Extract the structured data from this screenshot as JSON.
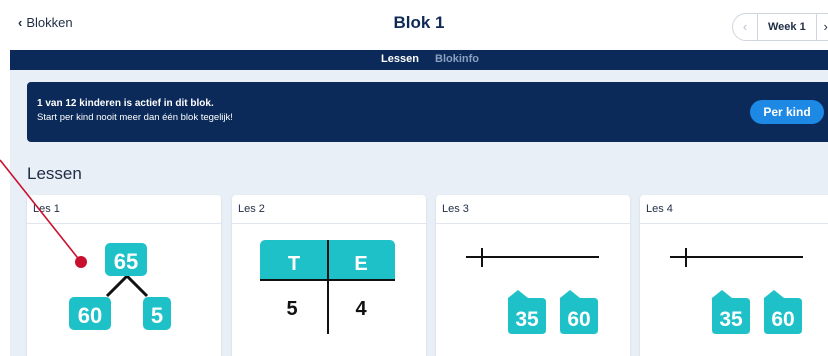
{
  "topbar": {
    "back_label": "Blokken",
    "title": "Blok 1",
    "week_label": "Week 1"
  },
  "subnav": {
    "tabs": [
      {
        "label": "Lessen",
        "active": true
      },
      {
        "label": "Blokinfo",
        "active": false
      }
    ]
  },
  "banner": {
    "line1": "1 van 12 kinderen is actief in dit blok.",
    "line2": "Start per kind nooit meer dan één blok tegelijk!",
    "button_label": "Per kind"
  },
  "section_title": "Lessen",
  "lessons": [
    {
      "label": "Les 1",
      "illustration": "number-split",
      "top": "65",
      "left": "60",
      "right": "5"
    },
    {
      "label": "Les 2",
      "illustration": "place-value-table",
      "headers": [
        "T",
        "E"
      ],
      "values": [
        "5",
        "4"
      ]
    },
    {
      "label": "Les 3",
      "illustration": "number-line",
      "tiles": [
        "35",
        "60"
      ]
    },
    {
      "label": "Les 4",
      "illustration": "number-line",
      "tiles": [
        "35",
        "60"
      ]
    }
  ],
  "colors": {
    "navy": "#0b2a59",
    "teal": "#1fc1c9",
    "button_blue": "#1e88e5",
    "pointer_red": "#c8102e"
  }
}
